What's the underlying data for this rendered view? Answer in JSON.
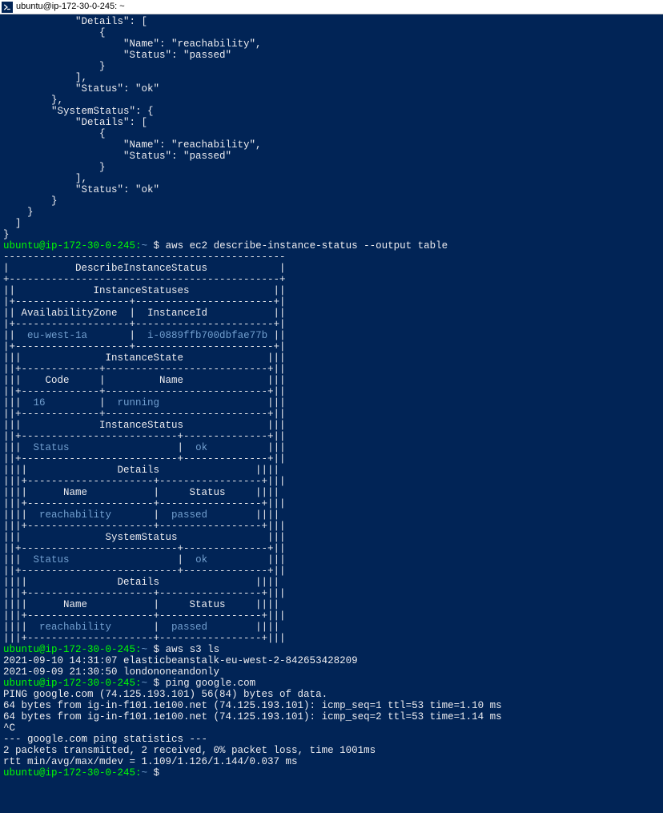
{
  "titlebar": {
    "text": "ubuntu@ip-172-30-0-245: ~"
  },
  "json_tail": [
    "            \"Details\": [",
    "                {",
    "                    \"Name\": \"reachability\",",
    "                    \"Status\": \"passed\"",
    "                }",
    "            ],",
    "            \"Status\": \"ok\"",
    "        },",
    "        \"SystemStatus\": {",
    "            \"Details\": [",
    "                {",
    "                    \"Name\": \"reachability\",",
    "                    \"Status\": \"passed\"",
    "                }",
    "            ],",
    "            \"Status\": \"ok\"",
    "        }",
    "    }",
    "  ]",
    "}"
  ],
  "prompt1": {
    "user": "ubuntu@ip-172-30-0-245:",
    "path": "~",
    "dollar": "$",
    "cmd": "aws ec2 describe-instance-status --output table"
  },
  "table": [
    {
      "t": "-----------------------------------------------",
      "pre": "",
      "suf": ""
    },
    {
      "t": "|           DescribeInstanceStatus            |",
      "pre": "",
      "suf": ""
    },
    {
      "t": "+---------------------------------------------+",
      "pre": "",
      "suf": ""
    },
    {
      "t": "||             InstanceStatuses              ||",
      "pre": "",
      "suf": ""
    },
    {
      "t": "|+-------------------+-----------------------+|",
      "pre": "",
      "suf": ""
    },
    {
      "t": "|| AvailabilityZone  |  InstanceId           ||",
      "pre": "",
      "suf": ""
    },
    {
      "t": "|+-------------------+-----------------------+|",
      "pre": "",
      "suf": ""
    },
    {
      "split": true,
      "pre": "||  ",
      "a": "eu-west-1a",
      "mid": "       |  ",
      "b": "i-0889ffb700dbfae77b",
      "suf": " ||"
    },
    {
      "t": "|+-------------------+-----------------------+|",
      "pre": "",
      "suf": ""
    },
    {
      "t": "|||              InstanceState              |||",
      "pre": "",
      "suf": ""
    },
    {
      "t": "||+-------------+---------------------------+||",
      "pre": "",
      "suf": ""
    },
    {
      "t": "|||    Code     |         Name              |||",
      "pre": "",
      "suf": ""
    },
    {
      "t": "||+-------------+---------------------------+||",
      "pre": "",
      "suf": ""
    },
    {
      "split": true,
      "pre": "|||  ",
      "a": "16",
      "mid": "         |  ",
      "b": "running",
      "suf": "                  |||"
    },
    {
      "t": "||+-------------+---------------------------+||",
      "pre": "",
      "suf": ""
    },
    {
      "t": "|||             InstanceStatus              |||",
      "pre": "",
      "suf": ""
    },
    {
      "t": "||+--------------------------+--------------+||",
      "pre": "",
      "suf": ""
    },
    {
      "split": true,
      "pre": "|||  ",
      "a": "Status",
      "mid": "                  |  ",
      "b": "ok",
      "suf": "          |||"
    },
    {
      "t": "||+--------------------------+--------------+||",
      "pre": "",
      "suf": ""
    },
    {
      "t": "||||               Details                ||||",
      "pre": "",
      "suf": ""
    },
    {
      "t": "|||+---------------------+-----------------+|||",
      "pre": "",
      "suf": ""
    },
    {
      "t": "||||      Name           |     Status     ||||",
      "pre": "",
      "suf": ""
    },
    {
      "t": "|||+---------------------+-----------------+|||",
      "pre": "",
      "suf": ""
    },
    {
      "split": true,
      "pre": "||||  ",
      "a": "reachability",
      "mid": "       |  ",
      "b": "passed",
      "suf": "        ||||"
    },
    {
      "t": "|||+---------------------+-----------------+|||",
      "pre": "",
      "suf": ""
    },
    {
      "t": "|||              SystemStatus               |||",
      "pre": "",
      "suf": ""
    },
    {
      "t": "||+--------------------------+--------------+||",
      "pre": "",
      "suf": ""
    },
    {
      "split": true,
      "pre": "|||  ",
      "a": "Status",
      "mid": "                  |  ",
      "b": "ok",
      "suf": "          |||"
    },
    {
      "t": "||+--------------------------+--------------+||",
      "pre": "",
      "suf": ""
    },
    {
      "t": "||||               Details                ||||",
      "pre": "",
      "suf": ""
    },
    {
      "t": "|||+---------------------+-----------------+|||",
      "pre": "",
      "suf": ""
    },
    {
      "t": "||||      Name           |     Status     ||||",
      "pre": "",
      "suf": ""
    },
    {
      "t": "|||+---------------------+-----------------+|||",
      "pre": "",
      "suf": ""
    },
    {
      "split": true,
      "pre": "||||  ",
      "a": "reachability",
      "mid": "       |  ",
      "b": "passed",
      "suf": "        ||||"
    },
    {
      "t": "|||+---------------------+-----------------+|||",
      "pre": "",
      "suf": ""
    }
  ],
  "prompt2": {
    "user": "ubuntu@ip-172-30-0-245:",
    "path": "~",
    "dollar": "$",
    "cmd": "aws s3 ls"
  },
  "s3_output": [
    "2021-09-10 14:31:07 elasticbeanstalk-eu-west-2-842653428209",
    "2021-09-09 21:30:50 londononeandonly"
  ],
  "prompt3": {
    "user": "ubuntu@ip-172-30-0-245:",
    "path": "~",
    "dollar": "$",
    "cmd": "ping google.com"
  },
  "ping_output": [
    "PING google.com (74.125.193.101) 56(84) bytes of data.",
    "64 bytes from ig-in-f101.1e100.net (74.125.193.101): icmp_seq=1 ttl=53 time=1.10 ms",
    "64 bytes from ig-in-f101.1e100.net (74.125.193.101): icmp_seq=2 ttl=53 time=1.14 ms",
    "^C",
    "--- google.com ping statistics ---",
    "2 packets transmitted, 2 received, 0% packet loss, time 1001ms",
    "rtt min/avg/max/mdev = 1.109/1.126/1.144/0.037 ms"
  ],
  "prompt4": {
    "user": "ubuntu@ip-172-30-0-245:",
    "path": "~",
    "dollar": "$",
    "cmd": ""
  }
}
